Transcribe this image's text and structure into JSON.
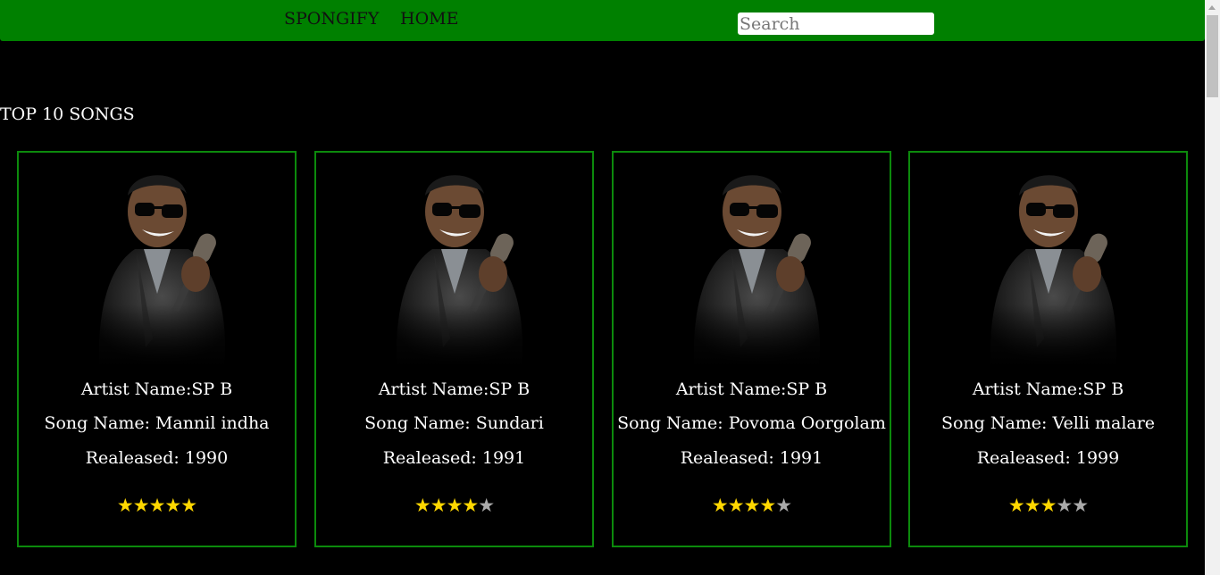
{
  "nav": {
    "brand": "SPONGIFY",
    "home": "HOME",
    "search_placeholder": "Search"
  },
  "section_title": "TOP 10 SONGS",
  "colors": {
    "navbar": "#008000",
    "card_border": "#0c8a0c",
    "star_on": "#ffd700",
    "star_off": "#aaaaaa"
  },
  "cards": [
    {
      "artist": "Artist Name:SP B",
      "song": "Song Name: Mannil indha",
      "released": "Realeased: 1990",
      "rating": 5,
      "max_rating": 5
    },
    {
      "artist": "Artist Name:SP B",
      "song": "Song Name: Sundari",
      "released": "Realeased: 1991",
      "rating": 4,
      "max_rating": 5
    },
    {
      "artist": "Artist Name:SP B",
      "song": "Song Name: Povoma Oorgolam",
      "released": "Realeased: 1991",
      "rating": 4,
      "max_rating": 5
    },
    {
      "artist": "Artist Name:SP B",
      "song": "Song Name: Velli malare",
      "released": "Realeased: 1999",
      "rating": 3,
      "max_rating": 5
    }
  ]
}
